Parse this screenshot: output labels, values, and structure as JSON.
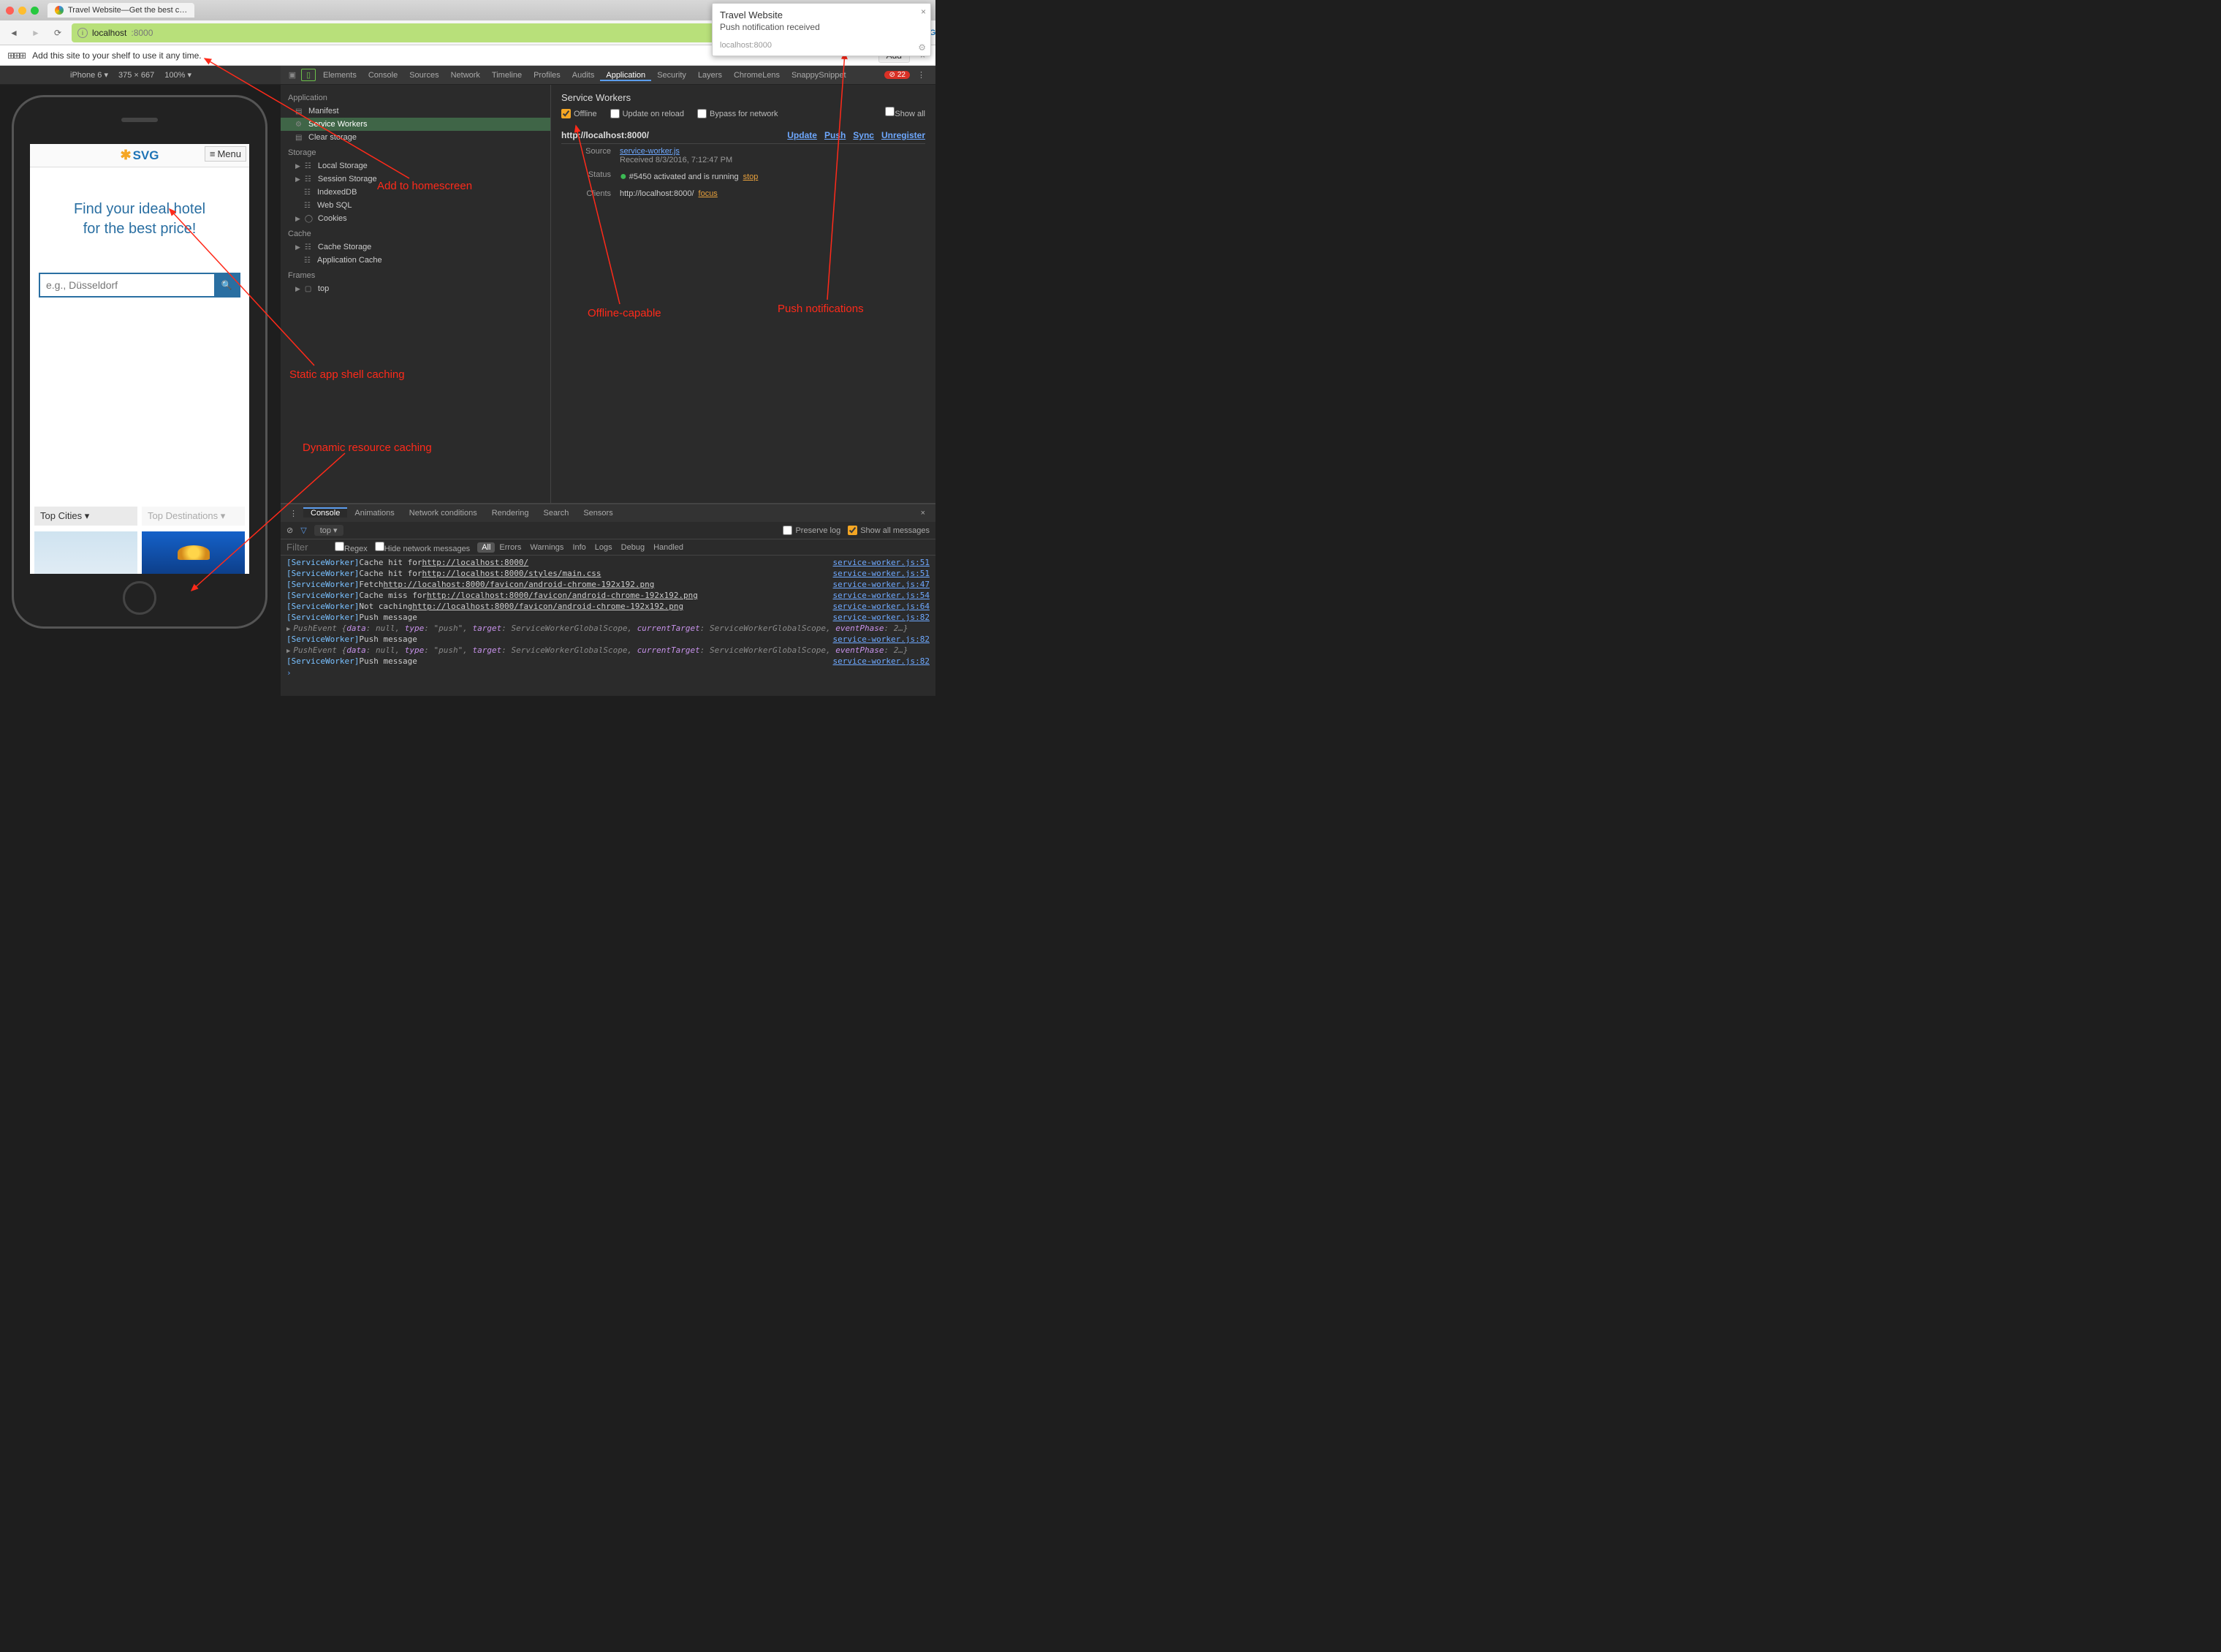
{
  "browser": {
    "tab_title": "Travel Website—Get the best c…",
    "url_host": "localhost",
    "url_port": ":8000",
    "shelf_text": "Add this site to your shelf to use it any time.",
    "shelf_add": "Add"
  },
  "notification": {
    "title": "Travel Website",
    "body": "Push notification received",
    "origin": "localhost:8000"
  },
  "device_toolbar": {
    "device": "iPhone 6 ▾",
    "dims": "375 × 667",
    "zoom": "100% ▾"
  },
  "app": {
    "brand": "SVG",
    "menu": "Menu",
    "hero_l1": "Find your ideal hotel",
    "hero_l2": "for the best price!",
    "search_placeholder": "e.g., Düsseldorf",
    "dd1": "Top Cities ▾",
    "dd2": "Top Destinations ▾"
  },
  "devtools": {
    "tabs": [
      "Elements",
      "Console",
      "Sources",
      "Network",
      "Timeline",
      "Profiles",
      "Audits",
      "Application",
      "Security",
      "Layers",
      "ChromeLens",
      "SnappySnippet"
    ],
    "active_tab": "Application",
    "error_count": "22",
    "side": {
      "application": {
        "label": "Application",
        "items": [
          "Manifest",
          "Service Workers",
          "Clear storage"
        ]
      },
      "storage": {
        "label": "Storage",
        "items": [
          "Local Storage",
          "Session Storage",
          "IndexedDB",
          "Web SQL",
          "Cookies"
        ]
      },
      "cache": {
        "label": "Cache",
        "items": [
          "Cache Storage",
          "Application Cache"
        ]
      },
      "frames": {
        "label": "Frames",
        "items": [
          "top"
        ]
      }
    },
    "sw": {
      "title": "Service Workers",
      "offline": "Offline",
      "update": "Update on reload",
      "bypass": "Bypass for network",
      "showall": "Show all",
      "origin": "http://localhost:8000/",
      "links": [
        "Update",
        "Push",
        "Sync",
        "Unregister"
      ],
      "source_label": "Source",
      "source": "service-worker.js",
      "received": "Received 8/3/2016, 7:12:47 PM",
      "status_label": "Status",
      "status": "#5450 activated and is running",
      "stop": "stop",
      "clients_label": "Clients",
      "client": "http://localhost:8000/",
      "focus": "focus"
    }
  },
  "drawer": {
    "tabs": [
      "Console",
      "Animations",
      "Network conditions",
      "Rendering",
      "Search",
      "Sensors"
    ],
    "ctx": "top",
    "preserve": "Preserve log",
    "showall": "Show all messages",
    "filter_ph": "Filter",
    "regex": "Regex",
    "hide": "Hide network messages",
    "levels": [
      "All",
      "Errors",
      "Warnings",
      "Info",
      "Logs",
      "Debug",
      "Handled"
    ]
  },
  "console_lines": [
    {
      "tag": "[ServiceWorker]",
      "msg": "Cache hit for ",
      "url": "http://localhost:8000/",
      "src": "service-worker.js:51"
    },
    {
      "tag": "[ServiceWorker]",
      "msg": "Cache hit for ",
      "url": "http://localhost:8000/styles/main.css",
      "src": "service-worker.js:51"
    },
    {
      "tag": "[ServiceWorker]",
      "msg": "Fetch ",
      "url": "http://localhost:8000/favicon/android-chrome-192x192.png",
      "src": "service-worker.js:47"
    },
    {
      "tag": "[ServiceWorker]",
      "msg": "Cache miss for ",
      "url": "http://localhost:8000/favicon/android-chrome-192x192.png",
      "src": "service-worker.js:54"
    },
    {
      "tag": "[ServiceWorker]",
      "msg": "Not caching ",
      "url": "http://localhost:8000/favicon/android-chrome-192x192.png",
      "src": "service-worker.js:64"
    },
    {
      "tag": "[ServiceWorker]",
      "msg": "Push message",
      "src": "service-worker.js:82"
    },
    {
      "pe": true,
      "text": "PushEvent {data: null, type: \"push\", target: ServiceWorkerGlobalScope, currentTarget: ServiceWorkerGlobalScope, eventPhase: 2…}"
    },
    {
      "tag": "[ServiceWorker]",
      "msg": "Push message",
      "src": "service-worker.js:82"
    },
    {
      "pe": true,
      "text": "PushEvent {data: null, type: \"push\", target: ServiceWorkerGlobalScope, currentTarget: ServiceWorkerGlobalScope, eventPhase: 2…}"
    },
    {
      "tag": "[ServiceWorker]",
      "msg": "Push message",
      "src": "service-worker.js:82"
    }
  ],
  "annotations": {
    "homescreen": "Add to homescreen",
    "shell": "Static app shell caching",
    "dynamic": "Dynamic resource caching",
    "offline": "Offline-capable",
    "push": "Push notifications"
  }
}
